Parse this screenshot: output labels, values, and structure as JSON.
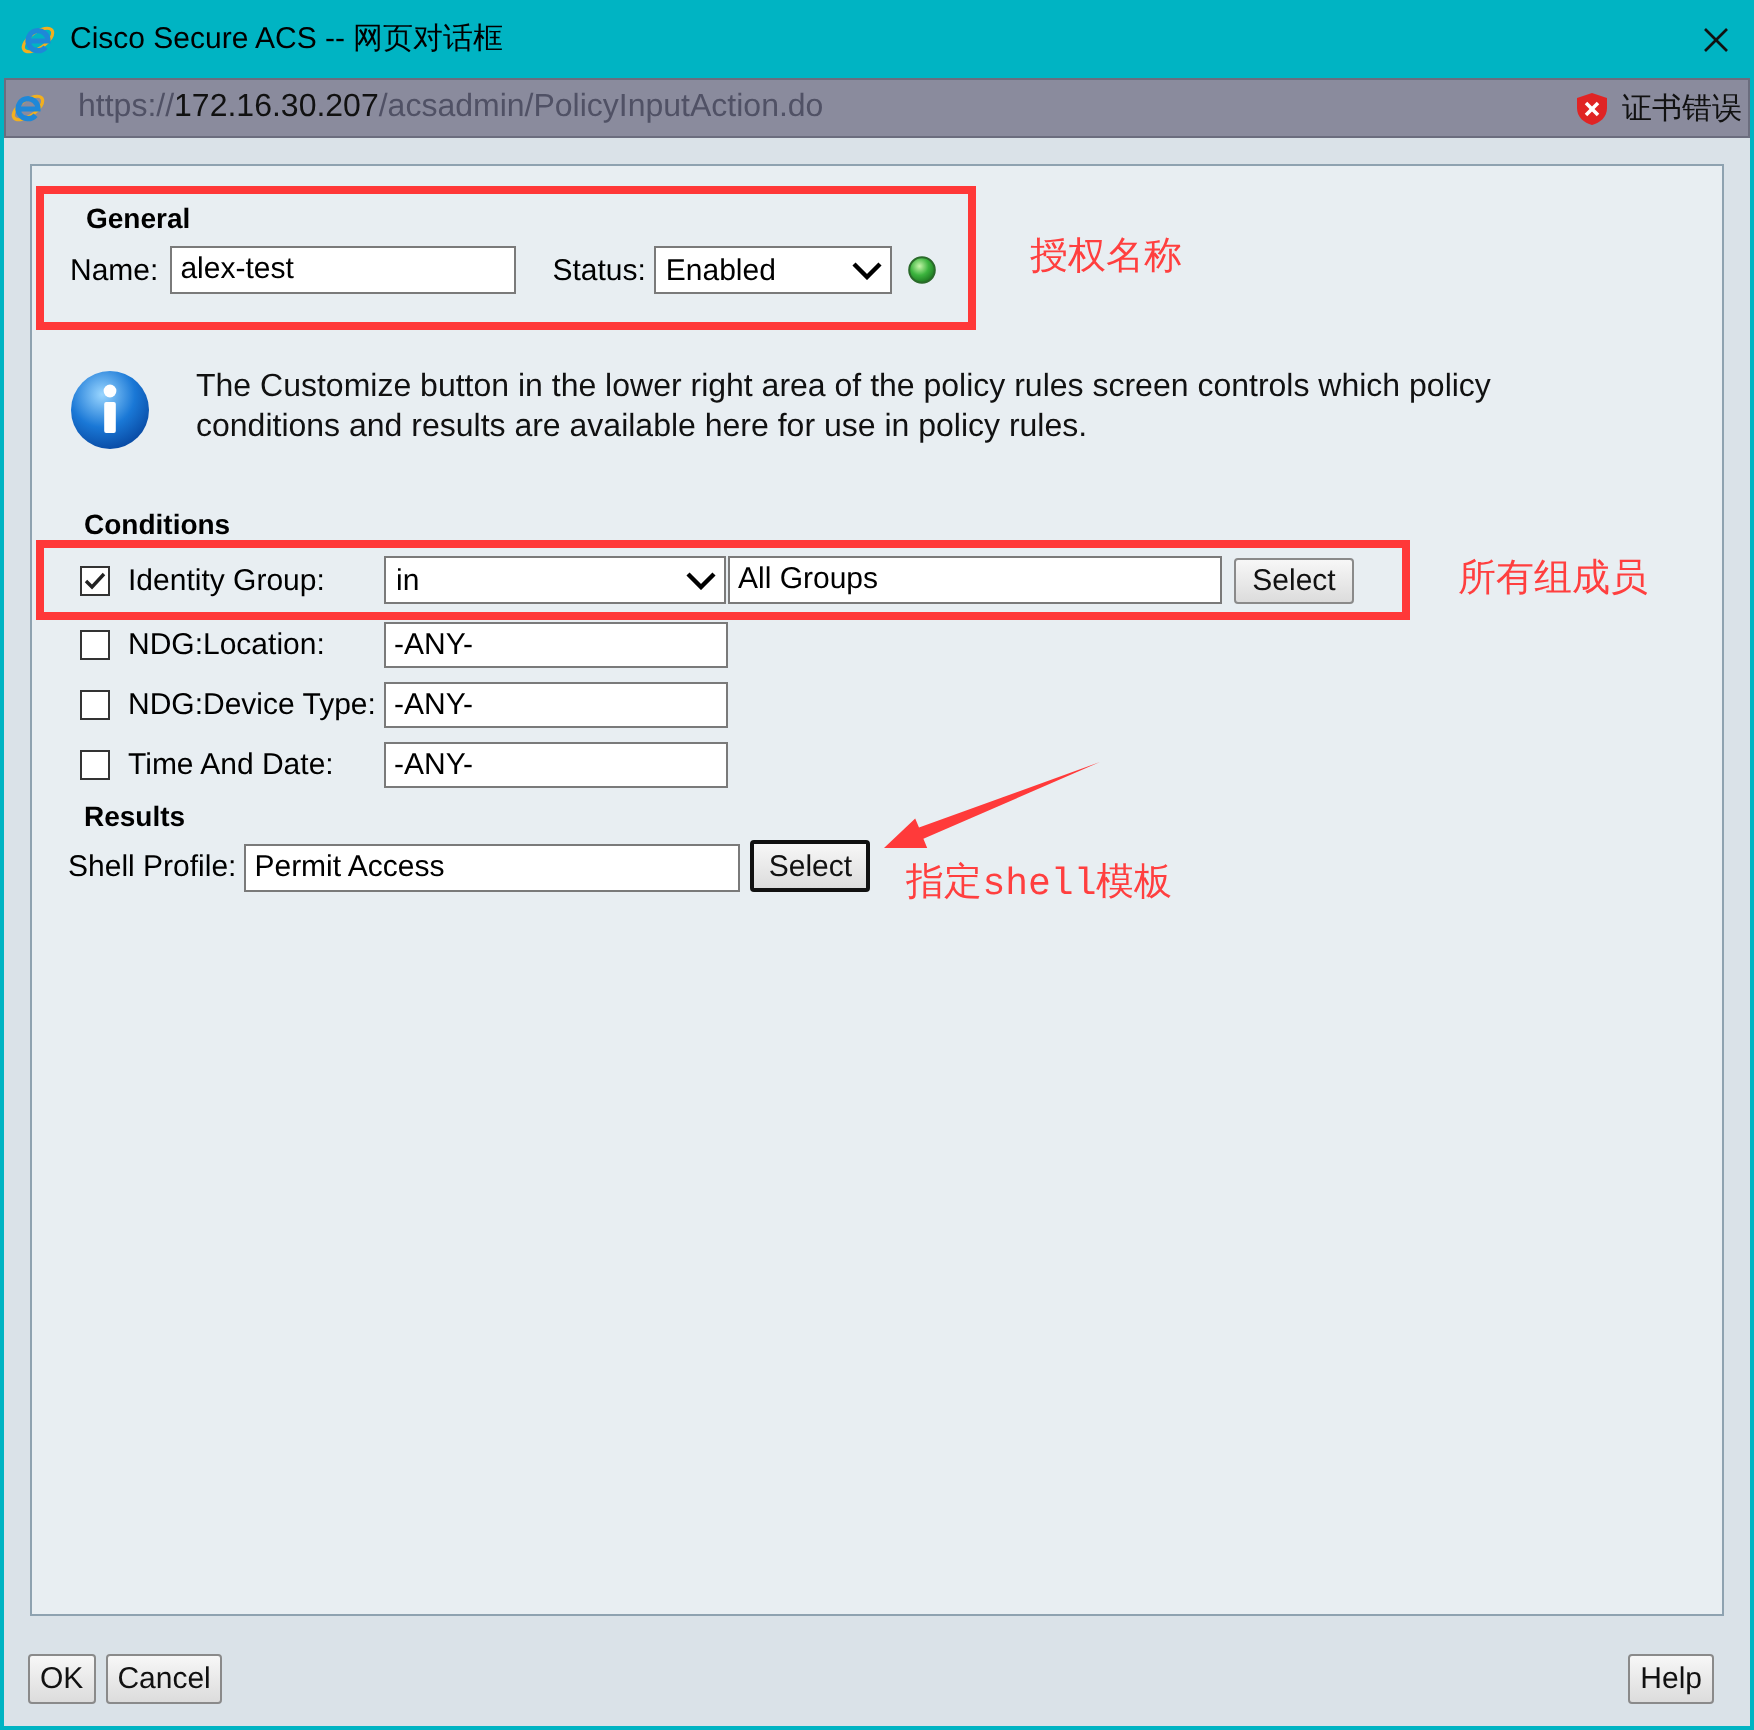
{
  "window": {
    "title": "Cisco Secure ACS -- 网页对话框"
  },
  "address_bar": {
    "scheme": "https://",
    "host": "172.16.30.207",
    "path": "/acsadmin/PolicyInputAction.do",
    "certificate_status": "证书错误"
  },
  "general": {
    "heading": "General",
    "highlighted": true,
    "annotation": "授权名称",
    "name_label": "Name:",
    "name_value": "alex-test",
    "status_label": "Status:",
    "status_value": "Enabled",
    "status_on": true
  },
  "info_message": "The Customize button in the lower right area of the policy rules screen controls which policy conditions and results are available here for use in policy rules.",
  "conditions": {
    "heading": "Conditions",
    "rows": [
      {
        "kind": "operator",
        "label": "Identity Group:",
        "checked": true,
        "highlighted": true,
        "annotation": "所有组成员",
        "operator": "in",
        "value": "All Groups",
        "button": "Select"
      },
      {
        "kind": "value",
        "label": "NDG:Location:",
        "checked": false,
        "highlighted": false,
        "value": "-ANY-"
      },
      {
        "kind": "value",
        "label": "NDG:Device Type:",
        "checked": false,
        "highlighted": false,
        "value": "-ANY-"
      },
      {
        "kind": "value",
        "label": "Time And Date:",
        "checked": false,
        "highlighted": false,
        "value": "-ANY-"
      }
    ]
  },
  "results": {
    "heading": "Results",
    "label": "Shell Profile:",
    "value": "Permit Access",
    "button": "Select",
    "annotation": "指定shell模板"
  },
  "footer": {
    "left_buttons": [
      "OK",
      "Cancel"
    ],
    "right_buttons": [
      "Help"
    ]
  }
}
